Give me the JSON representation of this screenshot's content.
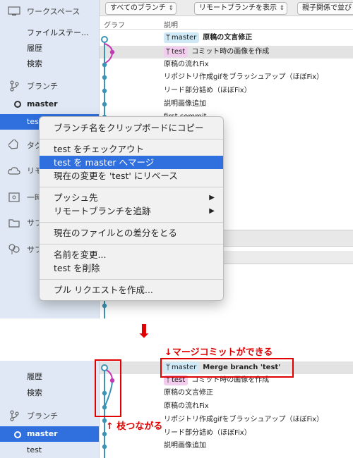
{
  "top": {
    "sidebar": {
      "workspace": "ワークスペース",
      "file_status": "ファイルステー...",
      "history": "履歴",
      "search": "検索",
      "branches": "ブランチ",
      "master": "master",
      "test": "test",
      "tags_partial": "タグ",
      "remote_partial": "リモ",
      "stash_partial": "一時",
      "submodule_partial": "サフ",
      "subtree_partial": "サフ"
    },
    "toolbar": {
      "all_branches": "すべてのブランチ",
      "show_remote": "リモートブランチを表示",
      "parent_order": "親子関係で並び"
    },
    "columns": {
      "graph": "グラフ",
      "description": "説明"
    },
    "commits": [
      {
        "branch": "master",
        "message": "原稿の文言修正",
        "bold": true
      },
      {
        "branch": "test",
        "message": "コミット時の画像を作成",
        "bold": false
      },
      {
        "branch": "",
        "message": "原稿の流れFix"
      },
      {
        "branch": "",
        "message": "リポジトリ作成gifをブラッシュアップ（ほぼFix）"
      },
      {
        "branch": "",
        "message": "リード部分詰め（ほぼFix）"
      },
      {
        "branch": "",
        "message": "説明画像追加"
      },
      {
        "branch": "",
        "message": "first commit"
      }
    ]
  },
  "context_menu": {
    "items": [
      "ブランチ名をクリップボードにコピー",
      "test をチェックアウト",
      "test を master へマージ",
      "現在の変更を 'test' にリベース",
      "プッシュ先",
      "リモートブランチを追跡",
      "現在のファイルとの差分をとる",
      "名前を変更...",
      "test を削除",
      "プル リクエストを作成..."
    ],
    "highlighted_index": 2
  },
  "arrow": "⬇",
  "bottom": {
    "annotation_merge": "↓マージコミットができる",
    "annotation_branch": "↑ 枝つながる",
    "sidebar": {
      "history": "履歴",
      "search": "検索",
      "branches": "ブランチ",
      "master": "master",
      "test": "test"
    },
    "commits": [
      {
        "branch": "master",
        "message": "Merge branch 'test'",
        "bold": true
      },
      {
        "branch": "test",
        "message": "コミット時の画像を作成",
        "bold": false
      },
      {
        "branch": "",
        "message": "原稿の文言修正"
      },
      {
        "branch": "",
        "message": "原稿の流れFix"
      },
      {
        "branch": "",
        "message": "リポジトリ作成gifをブラッシュアップ（ほぼFix）"
      },
      {
        "branch": "",
        "message": "リード部分詰め（ほぼFix）"
      },
      {
        "branch": "",
        "message": "説明画像追加"
      }
    ]
  },
  "colors": {
    "accent": "#2f6fde",
    "annotation": "#e10000",
    "graph_blue": "#3b93b6",
    "graph_pink": "#c33bb2"
  }
}
